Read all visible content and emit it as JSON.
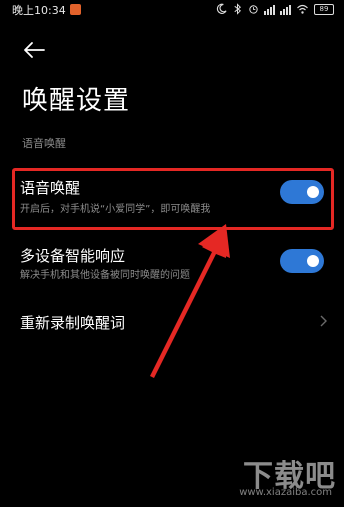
{
  "status_bar": {
    "time": "晚上10:34",
    "battery": "89"
  },
  "page": {
    "title": "唤醒设置",
    "section_header": "语音唤醒"
  },
  "settings": [
    {
      "title": "语音唤醒",
      "description": "开启后，对手机说“小爱同学”，即可唤醒我",
      "toggle_on": true
    },
    {
      "title": "多设备智能响应",
      "description": "解决手机和其他设备被同时唤醒的问题",
      "toggle_on": true
    },
    {
      "title": "重新录制唤醒词"
    }
  ],
  "colors": {
    "toggle_on": "#2e78d6",
    "highlight": "#e52824",
    "background": "#000000"
  },
  "watermark": {
    "logo": "下载吧",
    "url": "www.xiazaiba.com"
  }
}
